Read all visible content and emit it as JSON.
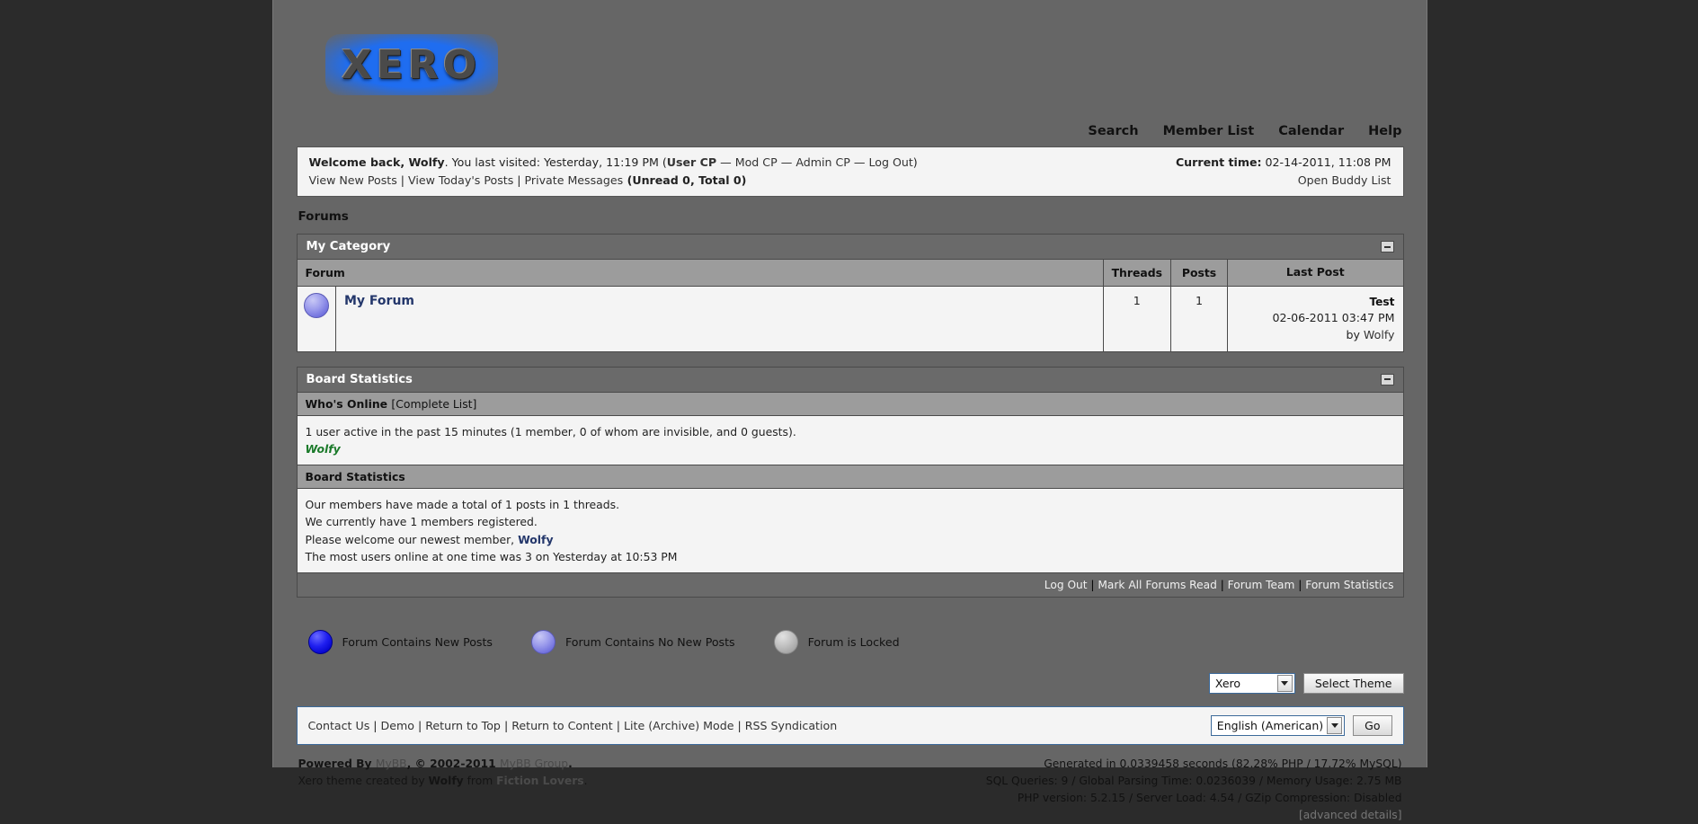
{
  "site": {
    "logo_text": "XERO"
  },
  "topnav": {
    "items": [
      "Search",
      "Member List",
      "Calendar",
      "Help"
    ]
  },
  "welcome": {
    "greeting_bold": "Welcome back, Wolfy",
    "visit_text": ". You last visited: Yesterday, 11:19 PM (",
    "user_cp": "User CP",
    "sep1": " — ",
    "mod_cp": "Mod CP",
    "sep2": " — ",
    "admin_cp": "Admin CP",
    "sep3": " — ",
    "log_out": "Log Out",
    "close_paren": ")",
    "view_new_posts": "View New Posts",
    "view_todays_posts": "View Today's Posts",
    "private_messages": "Private Messages",
    "pm_counts": " (Unread 0, Total 0)",
    "pipe": " | ",
    "current_time_label": "Current time:",
    "current_time_value": " 02-14-2011, 11:08 PM",
    "open_buddy_list": "Open Buddy List"
  },
  "breadcrumb": {
    "text": "Forums"
  },
  "category": {
    "title": "My Category",
    "columns": [
      "Forum",
      "Threads",
      "Posts",
      "Last Post"
    ],
    "rows": [
      {
        "icon": "forum-no-new-posts-icon",
        "name": "My Forum",
        "threads": "1",
        "posts": "1",
        "last_post_title": "Test",
        "last_post_date": "02-06-2011 03:47 PM",
        "last_post_by_prefix": "by ",
        "last_post_author": "Wolfy"
      }
    ]
  },
  "board_statistics": {
    "title": "Board Statistics",
    "whos_online": {
      "heading": "Who's Online",
      "complete_list": "[Complete List]",
      "summary": "1 user active in the past 15 minutes (1 member, 0 of whom are invisible, and 0 guests).",
      "users": [
        "Wolfy"
      ]
    },
    "stats": {
      "heading": "Board Statistics",
      "lines": [
        "Our members have made a total of 1 posts in 1 threads.",
        "We currently have 1 members registered.",
        "The most users online at one time was 3 on Yesterday at 10:53 PM"
      ],
      "welcome_prefix": "Please welcome our newest member, ",
      "newest_member": "Wolfy"
    },
    "footer_links": [
      "Log Out",
      "Mark All Forums Read",
      "Forum Team",
      "Forum Statistics"
    ]
  },
  "legend": [
    {
      "icon": "forum-new-posts-icon",
      "label": "Forum Contains New Posts"
    },
    {
      "icon": "forum-no-new-posts-icon",
      "label": "Forum Contains No New Posts"
    },
    {
      "icon": "forum-locked-icon",
      "label": "Forum is Locked"
    }
  ],
  "theme_bar": {
    "selected_theme": "Xero",
    "options": [
      "Xero"
    ],
    "button_label": "Select Theme"
  },
  "footer": {
    "links": [
      "Contact Us",
      "Demo",
      "Return to Top",
      "Return to Content",
      "Lite (Archive) Mode",
      "RSS Syndication"
    ],
    "selected_language": "English (American)",
    "language_options": [
      "English (American)"
    ],
    "go_label": "Go"
  },
  "credits": {
    "powered_prefix": "Powered By ",
    "mybb": "MyBB",
    "copyright": ", © 2002-2011 ",
    "mybb_group": "MyBB Group",
    "period": ".",
    "theme_prefix": "Xero theme created by ",
    "theme_author": "Wolfy",
    "theme_from": " from ",
    "theme_site": "Fiction Lovers",
    "theme_period": ".",
    "generated": "Generated in 0.0339458 seconds (82.28% PHP / 17.72% MySQL)",
    "queries": "SQL Queries: 9 / Global Parsing Time: 0.0236039 / Memory Usage: 2.75 MB",
    "php": "PHP version: 5.2.15 / Server Load: 4.54 / GZip Compression: Disabled",
    "advanced": "[advanced details]"
  },
  "colors": {
    "page_bg": "#666666",
    "outer_bg": "#2b2b2b",
    "panel_bg": "#f4f4f4",
    "header_bar": "#6a6a6a",
    "subheader_bar": "#9c9c9c",
    "accent_blue": "#1f6df0",
    "link_dark": "#24376b",
    "online_green": "#1b7a2a"
  }
}
